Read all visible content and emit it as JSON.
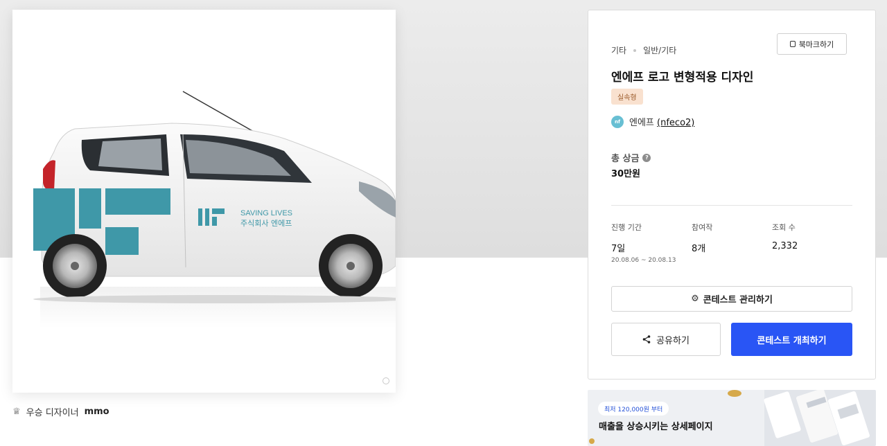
{
  "winner": {
    "label": "우승 디자이너",
    "name": "mmo"
  },
  "contest": {
    "category": "기타",
    "subcategory": "일반/기타",
    "bookmark_label": "북마크하기",
    "title": "엔에프 로고 변형적용 디자인",
    "badge": "실속형",
    "host_name": "엔에프",
    "host_handle": "(nfeco2)",
    "prize_label": "총 상금",
    "prize_value": "30만원"
  },
  "stats": {
    "period_label": "진행 기간",
    "period_value": "7일",
    "period_dates": "20.08.06 ~ 20.08.13",
    "entries_label": "참여작",
    "entries_value": "8개",
    "views_label": "조회 수",
    "views_value": "2,332"
  },
  "actions": {
    "manage_label": "콘테스트 관리하기",
    "share_label": "공유하기",
    "host_label": "콘테스트 개최하기"
  },
  "ad": {
    "pill": "최저 120,000원 부터",
    "headline": "매출을 상승시키는 상세페이지"
  },
  "artwork": {
    "line1": "SAVING LIVES",
    "line2": "주식회사 엔에프",
    "logo_mark": "nf"
  },
  "colors": {
    "primary": "#2955f5",
    "badge_bg": "#f9e1cf",
    "brand_teal": "#3f98a8"
  }
}
